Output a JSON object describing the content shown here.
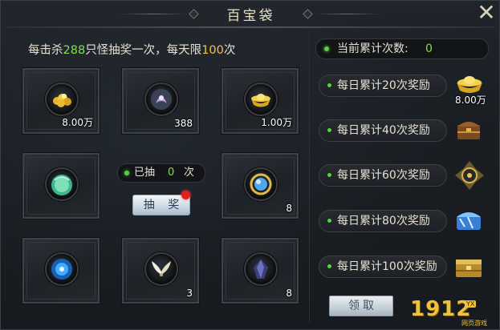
{
  "window": {
    "title": "百宝袋"
  },
  "info": {
    "prefix": "每击杀",
    "kill_count": "288",
    "middle": "只怪抽奖一次，每天限",
    "limit": "100",
    "suffix": "次"
  },
  "grid_items": [
    {
      "icon": "gold-nuggets-icon",
      "count": "8.00万"
    },
    {
      "icon": "spirit-orb-icon",
      "count": "388"
    },
    {
      "icon": "gold-ingot-icon",
      "count": "1.00万"
    },
    {
      "icon": "jade-orb-icon",
      "count": ""
    },
    {
      "icon": "golden-ring-orb-icon",
      "count": "8"
    },
    {
      "icon": "blue-energy-orb-icon",
      "count": ""
    },
    {
      "icon": "white-wings-icon",
      "count": "3"
    },
    {
      "icon": "dark-crystal-icon",
      "count": "8"
    }
  ],
  "draw": {
    "label_before": "已抽",
    "count": "0",
    "label_after": "次",
    "button": "抽 奖"
  },
  "total": {
    "label": "当前累计次数:",
    "value": "0"
  },
  "rewards": [
    {
      "label": "每日累计20次奖励",
      "icon": "gold-ingot-reward-icon",
      "count": "8.00万"
    },
    {
      "label": "每日累计40次奖励",
      "icon": "treasure-chest-icon",
      "count": ""
    },
    {
      "label": "每日累计60次奖励",
      "icon": "gilded-ornament-icon",
      "count": ""
    },
    {
      "label": "每日累计80次奖励",
      "icon": "crystal-chest-icon",
      "count": ""
    },
    {
      "label": "每日累计100次奖励",
      "icon": "golden-chest-icon",
      "count": ""
    }
  ],
  "claim_button": "领取",
  "watermark": {
    "text": "1912",
    "badge": "YX",
    "sub": "网页游戏"
  },
  "colors": {
    "highlight_green": "#7fe04a",
    "highlight_gold": "#f2c24a",
    "notify_red": "#e21e1e"
  }
}
